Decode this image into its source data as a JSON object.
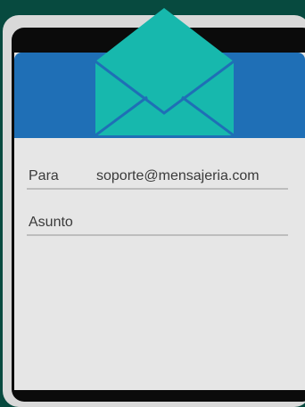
{
  "compose": {
    "icon": "envelope-icon",
    "to_label": "Para",
    "to_value": "soporte@mensajeria.com",
    "subject_label": "Asunto",
    "subject_value": ""
  },
  "colors": {
    "background": "#074a3f",
    "header": "#1f6fb6",
    "envelope": "#17b8ad",
    "envelope_lines": "#1f6fb6",
    "screen": "#e6e6e6"
  }
}
